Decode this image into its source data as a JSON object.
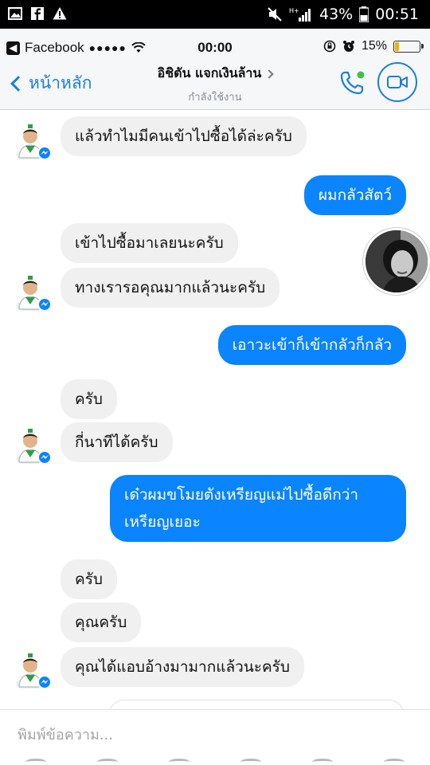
{
  "android_status": {
    "battery": "43%",
    "time": "00:51"
  },
  "ios_status": {
    "carrier": "Facebook",
    "signal_dots": "●●●●●",
    "time": "00:00",
    "battery": "15%"
  },
  "header": {
    "back_label": "หน้าหลัก",
    "contact_name": "อิชิตัน แจกเงินล้าน",
    "contact_status": "กำลังใช้งาน",
    "accent_color": "#1a7ee0"
  },
  "messages": [
    {
      "from": "them",
      "text": "แล้วทำไมมีคนเข้าไปซื้อได้ล่ะครับ"
    },
    {
      "from": "me",
      "text": "ผมกลัวสัตว์"
    },
    {
      "from": "them",
      "text": "เข้าไปซื้อมาเลยนะครับ"
    },
    {
      "from": "them",
      "text": "ทางเรารอคุณมากแล้วนะครับ"
    },
    {
      "from": "me",
      "text": "เอาวะเข้าก็เข้ากลัวก็กลัว"
    },
    {
      "from": "them",
      "text": "ครับ"
    },
    {
      "from": "them",
      "text": "กี่นาทีได้ครับ"
    },
    {
      "from": "me",
      "text": "เด๋วผมขโมยตังเหรียญแม่ไปซื้อดีกว่า เหรียญเยอะ"
    },
    {
      "from": "them",
      "text": "ครับ"
    },
    {
      "from": "them",
      "text": "คุณครับ"
    },
    {
      "from": "them",
      "text": "คุณได้แอบอ้างมามากแล้วนะครับ"
    }
  ],
  "composer": {
    "placeholder": "พิมพ์ข้อความ..."
  }
}
